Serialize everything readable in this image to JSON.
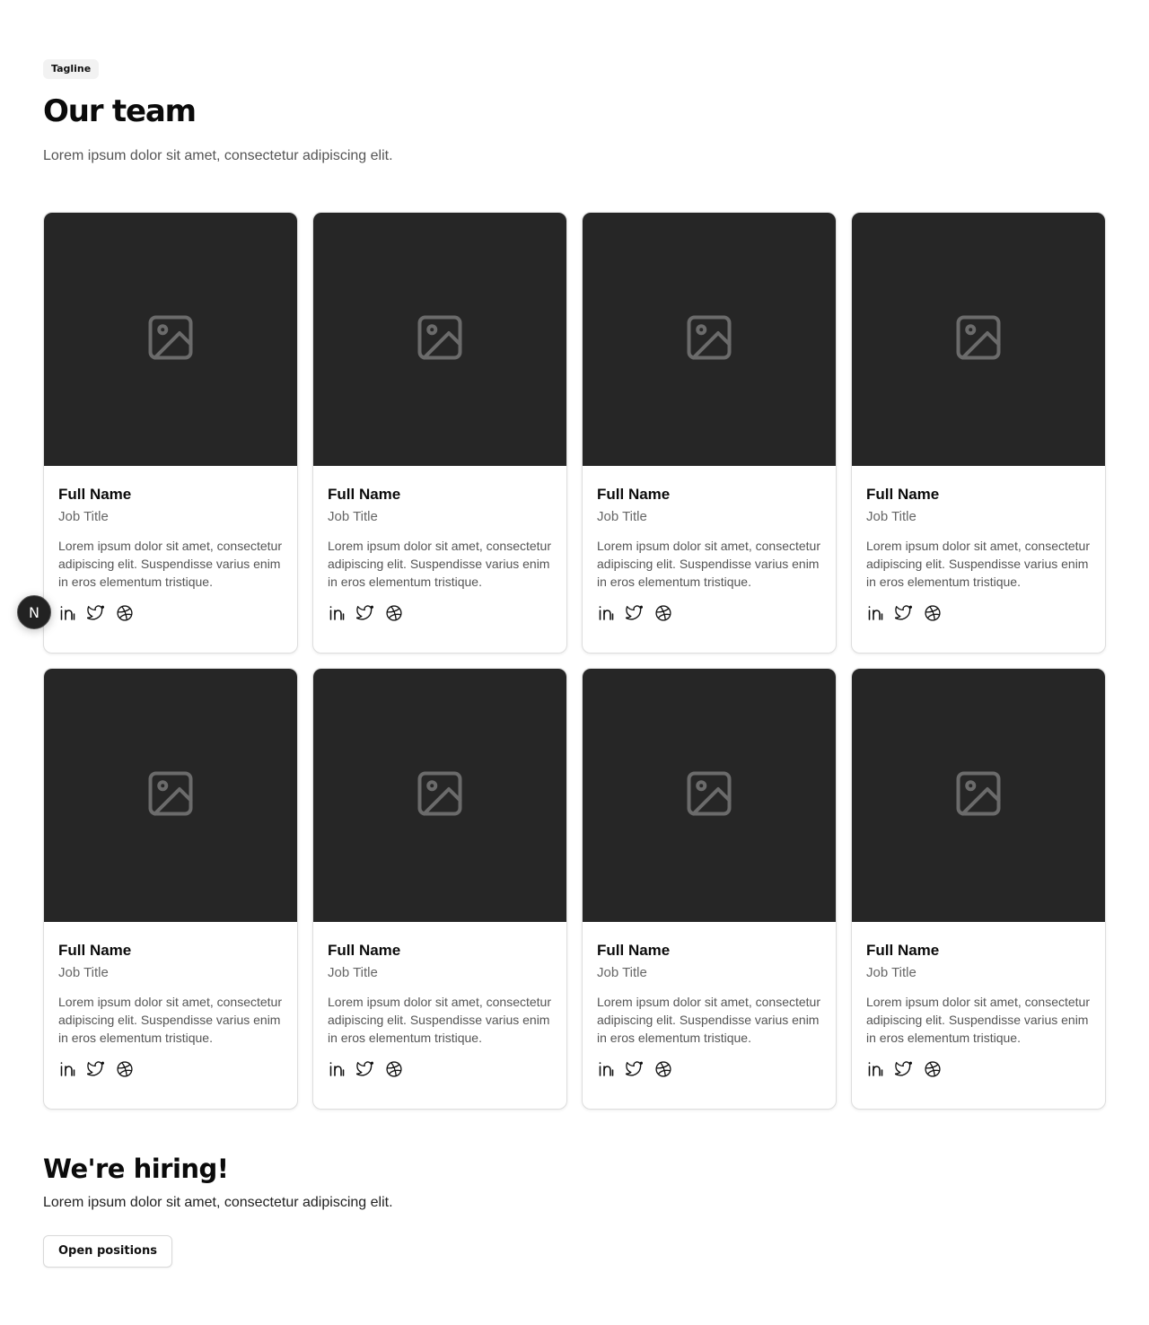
{
  "header": {
    "tagline": "Tagline",
    "title": "Our team",
    "subtitle": "Lorem ipsum dolor sit amet, consectetur adipiscing elit."
  },
  "team": [
    {
      "name": "Full Name",
      "job_title": "Job Title",
      "bio": "Lorem ipsum dolor sit amet, consectetur adipiscing elit. Suspendisse varius enim in eros elementum tristique.",
      "image_icon": "image-placeholder-icon",
      "socials": [
        "linkedin-icon",
        "twitter-icon",
        "dribbble-icon"
      ]
    },
    {
      "name": "Full Name",
      "job_title": "Job Title",
      "bio": "Lorem ipsum dolor sit amet, consectetur adipiscing elit. Suspendisse varius enim in eros elementum tristique.",
      "image_icon": "image-placeholder-icon",
      "socials": [
        "linkedin-icon",
        "twitter-icon",
        "dribbble-icon"
      ]
    },
    {
      "name": "Full Name",
      "job_title": "Job Title",
      "bio": "Lorem ipsum dolor sit amet, consectetur adipiscing elit. Suspendisse varius enim in eros elementum tristique.",
      "image_icon": "image-placeholder-icon",
      "socials": [
        "linkedin-icon",
        "twitter-icon",
        "dribbble-icon"
      ]
    },
    {
      "name": "Full Name",
      "job_title": "Job Title",
      "bio": "Lorem ipsum dolor sit amet, consectetur adipiscing elit. Suspendisse varius enim in eros elementum tristique.",
      "image_icon": "image-placeholder-icon",
      "socials": [
        "linkedin-icon",
        "twitter-icon",
        "dribbble-icon"
      ]
    },
    {
      "name": "Full Name",
      "job_title": "Job Title",
      "bio": "Lorem ipsum dolor sit amet, consectetur adipiscing elit. Suspendisse varius enim in eros elementum tristique.",
      "image_icon": "image-placeholder-icon",
      "socials": [
        "linkedin-icon",
        "twitter-icon",
        "dribbble-icon"
      ]
    },
    {
      "name": "Full Name",
      "job_title": "Job Title",
      "bio": "Lorem ipsum dolor sit amet, consectetur adipiscing elit. Suspendisse varius enim in eros elementum tristique.",
      "image_icon": "image-placeholder-icon",
      "socials": [
        "linkedin-icon",
        "twitter-icon",
        "dribbble-icon"
      ]
    },
    {
      "name": "Full Name",
      "job_title": "Job Title",
      "bio": "Lorem ipsum dolor sit amet, consectetur adipiscing elit. Suspendisse varius enim in eros elementum tristique.",
      "image_icon": "image-placeholder-icon",
      "socials": [
        "linkedin-icon",
        "twitter-icon",
        "dribbble-icon"
      ]
    },
    {
      "name": "Full Name",
      "job_title": "Job Title",
      "bio": "Lorem ipsum dolor sit amet, consectetur adipiscing elit. Suspendisse varius enim in eros elementum tristique.",
      "image_icon": "image-placeholder-icon",
      "socials": [
        "linkedin-icon",
        "twitter-icon",
        "dribbble-icon"
      ]
    }
  ],
  "hiring": {
    "title": "We're hiring!",
    "text": "Lorem ipsum dolor sit amet, consectetur adipiscing elit.",
    "button_label": "Open positions"
  },
  "devtools_badge": {
    "label": "N",
    "icon": "nextjs-devtools-icon"
  },
  "colors": {
    "background": "#ffffff",
    "image_placeholder": "#262626",
    "placeholder_icon": "#6b6b6b",
    "muted_text": "#666666",
    "heading": "#0b0b0b"
  }
}
